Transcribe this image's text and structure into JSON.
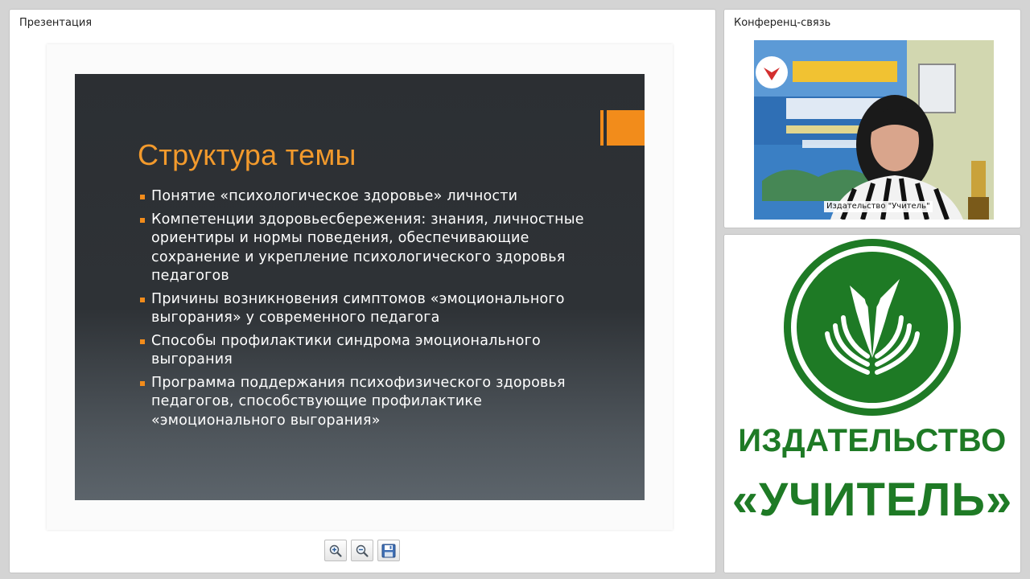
{
  "presentation_panel": {
    "title": "Презентация",
    "slide": {
      "title": "Структура темы",
      "bullets": [
        "Понятие «психологическое здоровье» личности",
        "Компетенции здоровьесбережения: знания, личностные ориентиры и нормы поведения, обеспечивающие сохранение и укрепление психологического здоровья педагогов",
        "Причины возникновения симптомов «эмоционального выгорания» у современного педагога",
        "Способы профилактики синдрома эмоционального выгорания",
        "Программа поддержания психофизического здоровья педагогов, способствующие профилактике «эмоционального выгорания»"
      ],
      "accent_color": "#f28c1b",
      "title_color": "#f39a2c"
    },
    "toolbar": {
      "buttons": [
        "zoom-in-icon",
        "zoom-out-icon",
        "save-icon"
      ]
    }
  },
  "conference_panel": {
    "title": "Конференц-связь",
    "participant_name": "Издательство \"Учитель\""
  },
  "logo_panel": {
    "line1": "ИЗДАТЕЛЬСТВО",
    "line2": "«УЧИТЕЛЬ»",
    "brand_color": "#1e7a25"
  }
}
